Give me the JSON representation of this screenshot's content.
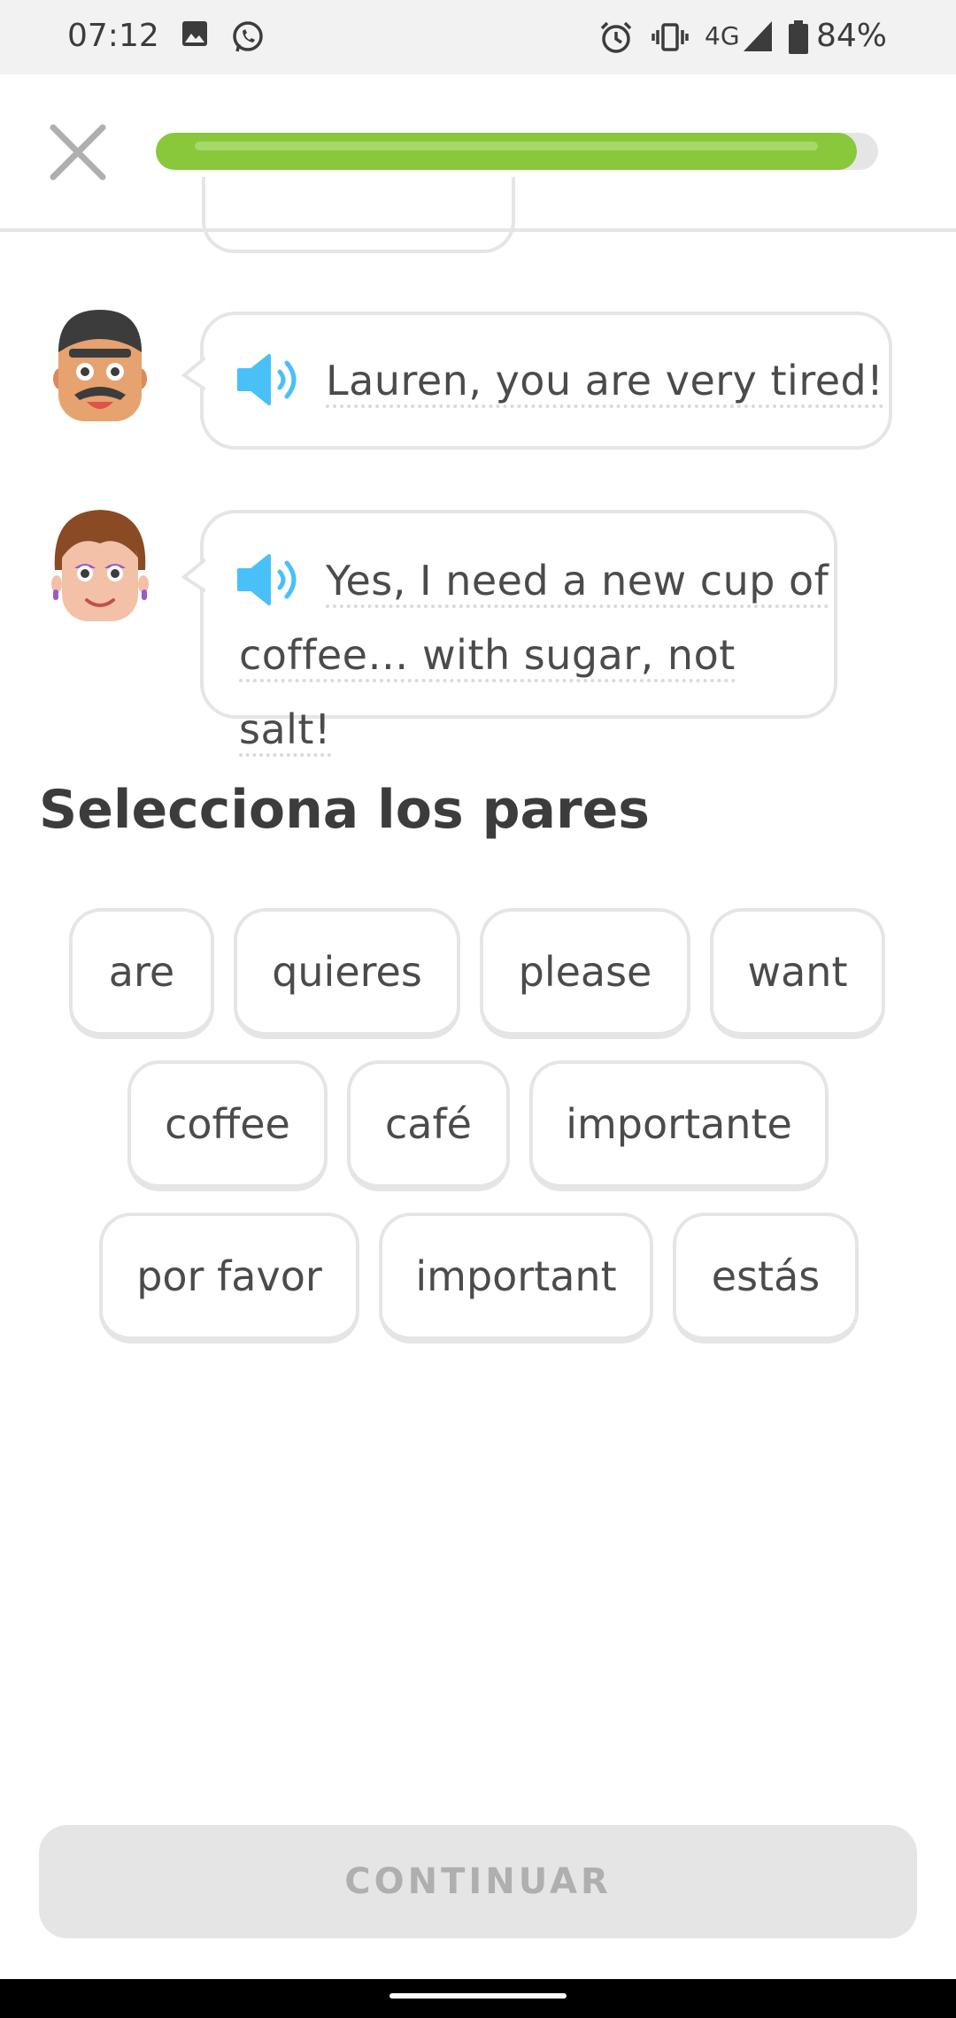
{
  "status_bar": {
    "time": "07:12",
    "network": "4G",
    "battery": "84%",
    "icons": [
      "image-icon",
      "whatsapp-icon",
      "alarm-icon",
      "vibrate-icon",
      "signal-icon",
      "battery-icon"
    ]
  },
  "header": {
    "progress": 0.97,
    "progress_color": "#89c83a"
  },
  "dialogue": [
    {
      "speaker": "man",
      "text_line1": "Lauren, you are very tired!",
      "text_line2": ""
    },
    {
      "speaker": "woman",
      "text_line1": "Yes, I need a new cup of",
      "text_line2": "coffee… with sugar, not salt!"
    }
  ],
  "exercise": {
    "title": "Selecciona los pares",
    "tiles": [
      "are",
      "quieres",
      "please",
      "want",
      "coffee",
      "café",
      "importante",
      "por favor",
      "important",
      "estás"
    ]
  },
  "footer": {
    "continue_label": "CONTINUAR"
  }
}
